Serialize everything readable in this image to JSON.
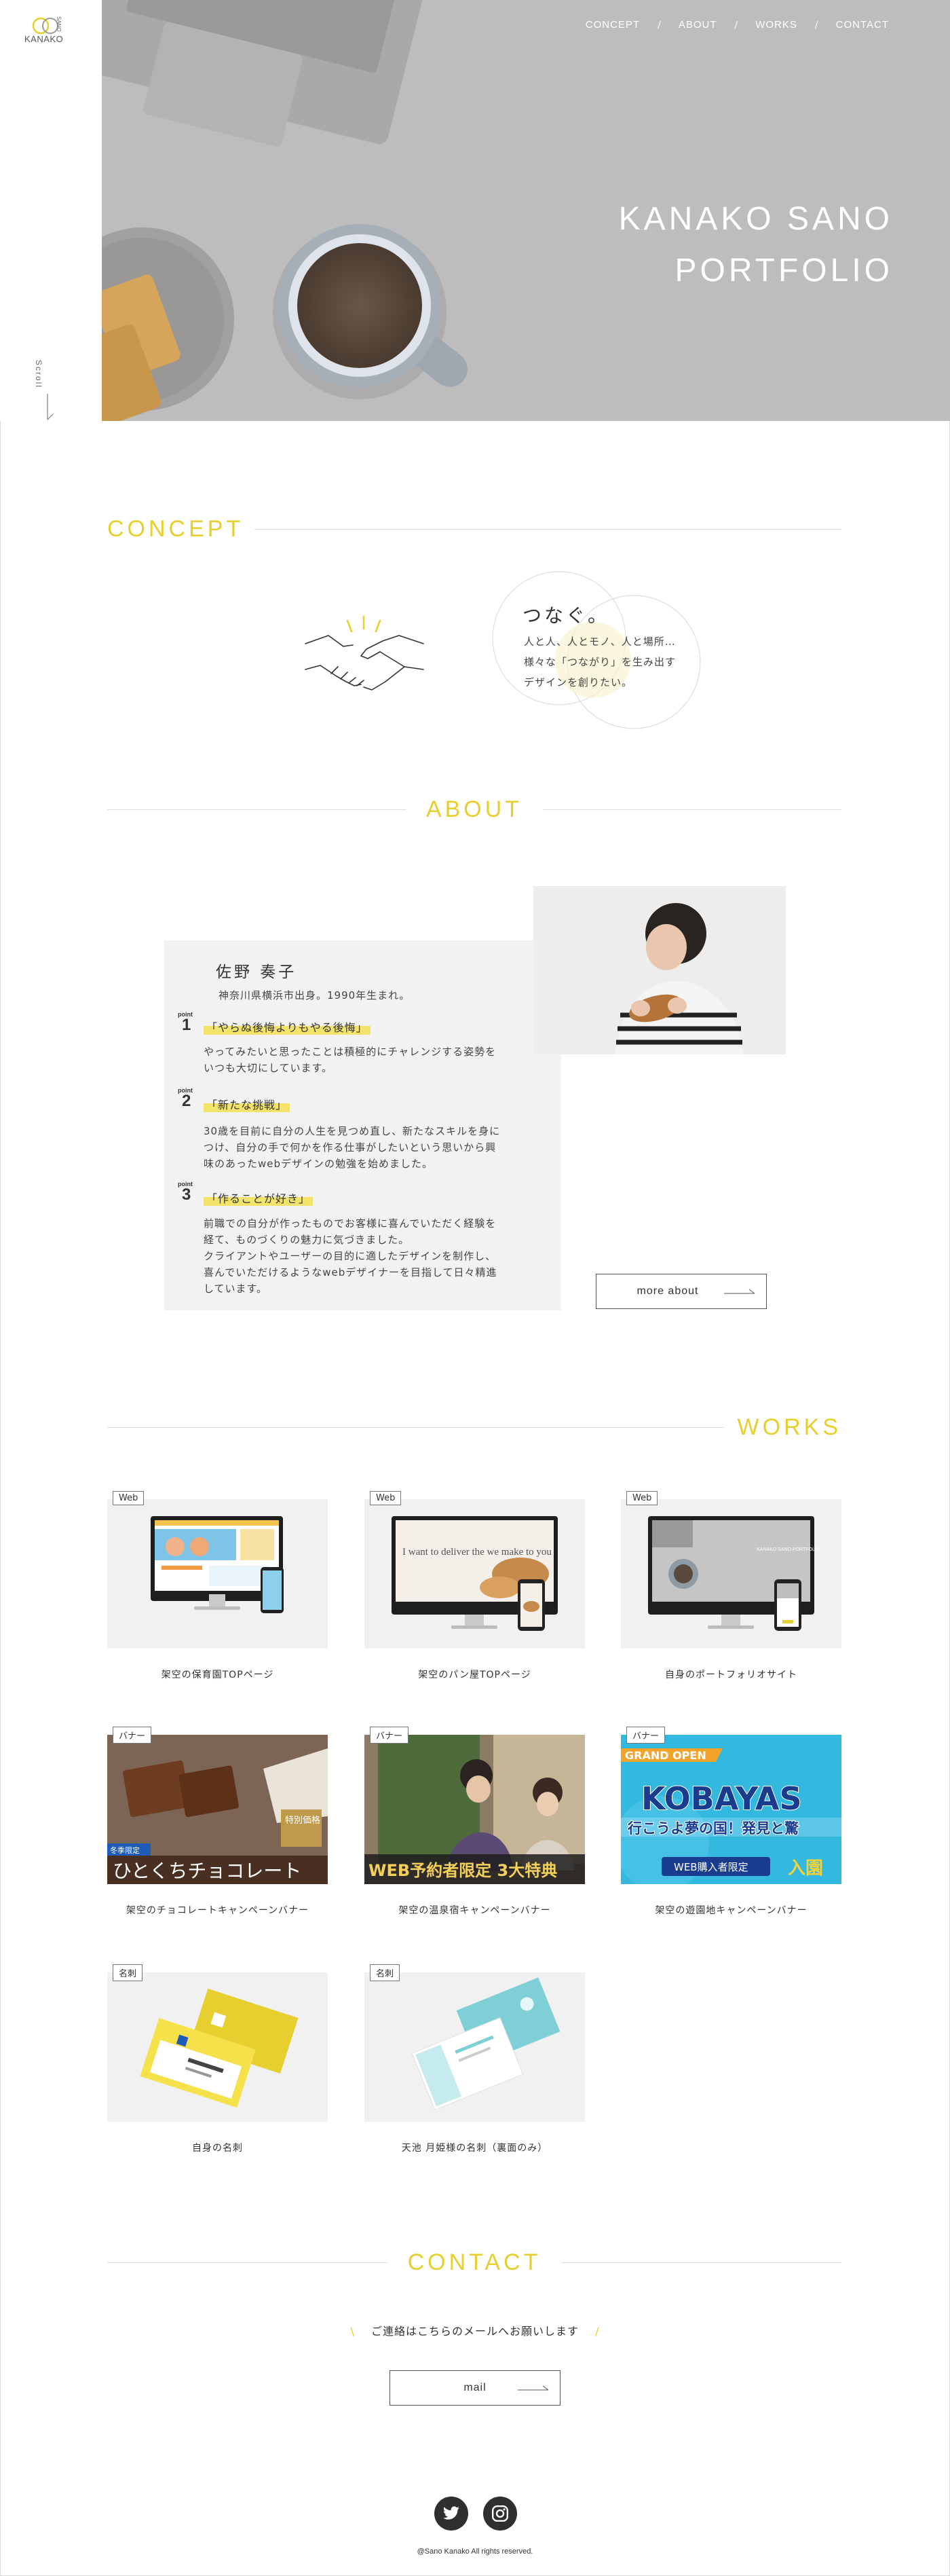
{
  "logo": {
    "text": "KANAKO",
    "arc_text": "SANO"
  },
  "sidebar": {
    "scroll_label": "Scroll"
  },
  "nav": {
    "items": [
      "CONCEPT",
      "ABOUT",
      "WORKS",
      "CONTACT"
    ],
    "separator": "/"
  },
  "hero": {
    "title_line1": "KANAKO SANO",
    "title_line2": "PORTFOLIO"
  },
  "concept": {
    "heading": "CONCEPT",
    "headline": "つなぐ。",
    "body_line1": "人と人、人とモノ、人と場所…",
    "body_line2": "様々な「つながり」を生み出す",
    "body_line3": "デザインを創りたい。"
  },
  "about": {
    "heading": "ABOUT",
    "name": "佐野 奏子",
    "origin": "神奈川県横浜市出身。1990年生まれ。",
    "point_label": "point",
    "points": [
      {
        "num": "1",
        "title": "「やらぬ後悔よりもやる後悔」",
        "lines": [
          "やってみたいと思ったことは積極的にチャレンジする姿勢を",
          "いつも大切にしています。"
        ]
      },
      {
        "num": "2",
        "title": "「新たな挑戦」",
        "lines": [
          "30歳を目前に自分の人生を見つめ直し、新たなスキルを身に",
          "つけ、自分の手で何かを作る仕事がしたいという思いから興",
          "味のあったwebデザインの勉強を始めました。"
        ]
      },
      {
        "num": "3",
        "title": "「作ることが好き」",
        "lines": [
          "前職での自分が作ったものでお客様に喜んでいただく経験を",
          "経て、ものづくりの魅力に気づきました。",
          "クライアントやユーザーの目的に適したデザインを制作し、",
          "喜んでいただけるようなwebデザイナーを目指して日々精進",
          "しています。"
        ]
      }
    ],
    "button": "more about"
  },
  "works": {
    "heading": "WORKS",
    "items": [
      {
        "tag": "Web",
        "caption": "架空の保育園TOPページ"
      },
      {
        "tag": "Web",
        "caption": "架空のパン屋TOPページ",
        "screen_text": "I want to deliver the we make to you"
      },
      {
        "tag": "Web",
        "caption": "自身のポートフォリオサイト",
        "screen_text": "KANAKO SANO PORTFOLIO"
      },
      {
        "tag": "バナー",
        "caption": "架空のチョコレートキャンペーンバナー",
        "banner_text": "ひとくちチョコレート",
        "badge_text": "特別価格",
        "sub_text": "冬季限定"
      },
      {
        "tag": "バナー",
        "caption": "架空の温泉宿キャンペーンバナー",
        "banner_text": "WEB予約者限定 3大特典"
      },
      {
        "tag": "バナー",
        "caption": "架空の遊園地キャンペーンバナー",
        "banner_ribbon": "GRAND OPEN",
        "banner_title": "KOBAYAS",
        "banner_sub": "行こうよ夢の国！発見と驚",
        "banner_bottom": "WEB購入者限定",
        "banner_enter": "入園"
      },
      {
        "tag": "名刺",
        "caption": "自身の名刺"
      },
      {
        "tag": "名刺",
        "caption": "天池 月姫様の名刺（裏面のみ）"
      }
    ]
  },
  "contact": {
    "heading": "CONTACT",
    "lead": "ご連絡はこちらのメールへお願いします",
    "button": "mail"
  },
  "footer": {
    "copyright": "@Sano Kanako All rights reserved."
  },
  "colors": {
    "accent": "#e6cf2e",
    "hero_bg": "#bdbdbd",
    "card_bg": "#f2f2f2",
    "highlight": "#f3e36a"
  },
  "icons": [
    "twitter-icon",
    "instagram-icon",
    "handshake-icon",
    "arrow-right-icon",
    "scroll-arrow-icon"
  ]
}
